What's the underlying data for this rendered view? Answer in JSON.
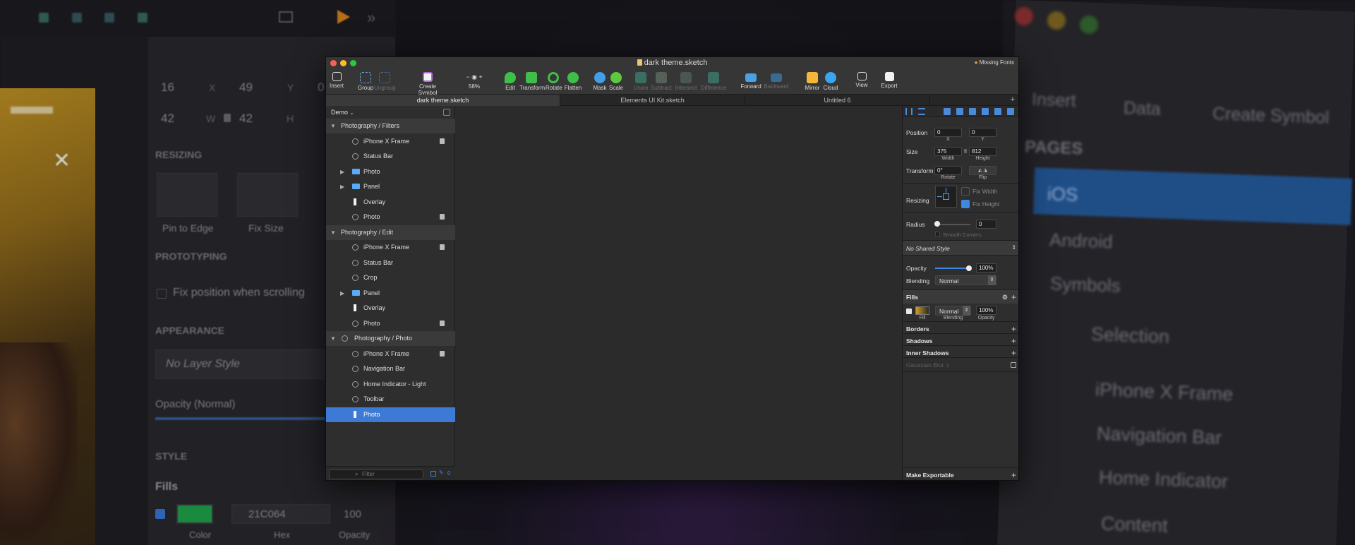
{
  "background": {
    "left_fields": [
      "16",
      "X",
      "49",
      "Y",
      "0",
      "42",
      "W",
      "42",
      "H"
    ],
    "resizing_title": "RESIZING",
    "pin_to_edge": "Pin to Edge",
    "fix_size": "Fix Size",
    "prototyping_title": "PROTOTYPING",
    "fix_position": "Fix position when scrolling",
    "appearance_title": "APPEARANCE",
    "no_layer_style": "No Layer Style",
    "opacity_label": "Opacity (Normal)",
    "style_title": "STYLE",
    "fills_title": "Fills",
    "hex_value": "21C064",
    "hex_opacity": "100",
    "fill_labels": [
      "Color",
      "Hex",
      "Opacity"
    ],
    "right_toolbar": [
      "Insert",
      "Data",
      "Create Symbol"
    ],
    "pages_title": "PAGES",
    "pages": [
      "iOS",
      "Android",
      "Symbols"
    ],
    "right_layers": [
      "Selection",
      "iPhone X Frame",
      "Navigation Bar",
      "Home Indicator",
      "Content"
    ]
  },
  "window": {
    "title": "dark theme.sketch",
    "missing_fonts": "Missing Fonts",
    "toolbar": {
      "insert": "Insert",
      "group": "Group",
      "ungroup": "Ungroup",
      "create_symbol": "Create Symbol",
      "zoom": "58%",
      "edit": "Edit",
      "transform": "Transform",
      "rotate": "Rotate",
      "flatten": "Flatten",
      "mask": "Mask",
      "scale": "Scale",
      "union": "Union",
      "subtract": "Subtract",
      "intersect": "Intersect",
      "difference": "Difference",
      "forward": "Forward",
      "backward": "Backward",
      "mirror": "Mirror",
      "cloud": "Cloud",
      "view": "View",
      "export": "Export"
    },
    "tabs": [
      "dark theme.sketch",
      "Elements UI Kit.sketch",
      "Untitled 6"
    ],
    "page_selector": "Demo",
    "layers": [
      {
        "label": "Photography / Filters",
        "type": "group"
      },
      {
        "label": "iPhone X Frame",
        "type": "symbol",
        "locked": true
      },
      {
        "label": "Status Bar",
        "type": "symbol"
      },
      {
        "label": "Photo",
        "type": "folder"
      },
      {
        "label": "Panel",
        "type": "folder"
      },
      {
        "label": "Overlay",
        "type": "rect"
      },
      {
        "label": "Photo",
        "type": "symbol",
        "locked": true
      },
      {
        "label": "Photography / Edit",
        "type": "group"
      },
      {
        "label": "iPhone X Frame",
        "type": "symbol",
        "locked": true
      },
      {
        "label": "Status Bar",
        "type": "symbol"
      },
      {
        "label": "Crop",
        "type": "symbol"
      },
      {
        "label": "Panel",
        "type": "folder"
      },
      {
        "label": "Overlay",
        "type": "rect"
      },
      {
        "label": "Photo",
        "type": "symbol",
        "locked": true
      },
      {
        "label": "Photography / Photo",
        "type": "group-symbol"
      },
      {
        "label": "iPhone X Frame",
        "type": "symbol",
        "locked": true
      },
      {
        "label": "Navigation Bar",
        "type": "symbol"
      },
      {
        "label": "Home Indicator - Light",
        "type": "symbol"
      },
      {
        "label": "Toolbar",
        "type": "symbol"
      },
      {
        "label": "Photo",
        "type": "rect",
        "selected": true
      }
    ],
    "filter_placeholder": "Filter",
    "filter_count": "0",
    "inspector": {
      "position_label": "Position",
      "x": "0",
      "y": "0",
      "x_label": "X",
      "y_label": "Y",
      "size_label": "Size",
      "width": "375",
      "height": "812",
      "width_label": "Width",
      "height_label": "Height",
      "transform_label": "Transform",
      "rotate_value": "0°",
      "rotate_label": "Rotate",
      "flip_label": "Flip",
      "resizing_label": "Resizing",
      "fix_width": "Fix Width",
      "fix_height": "Fix Height",
      "radius_label": "Radius",
      "radius_value": "0",
      "smooth_corners": "Smooth Corners",
      "shared_style": "No Shared Style",
      "opacity_label": "Opacity",
      "opacity_value": "100%",
      "opacity_level": 1.0,
      "blending_label": "Blending",
      "blending_value": "Normal",
      "fills_title": "Fills",
      "fill_blend": "Normal",
      "fill_opacity": "100%",
      "fill_sub": [
        "Fill",
        "Blending",
        "Opacity"
      ],
      "borders": "Borders",
      "shadows": "Shadows",
      "inner_shadows": "Inner Shadows",
      "gaussian_blur": "Gaussian Blur",
      "make_exportable": "Make Exportable"
    }
  }
}
